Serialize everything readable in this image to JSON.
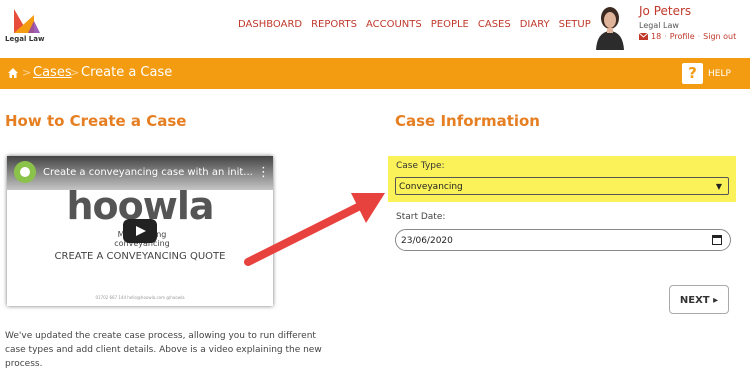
{
  "header": {
    "logo_text": "Legal Law",
    "nav": [
      "DASHBOARD",
      "REPORTS",
      "ACCOUNTS",
      "PEOPLE",
      "CASES",
      "DIARY",
      "SETUP"
    ],
    "user": {
      "name": "Jo Peters",
      "org": "Legal Law",
      "messages_count": "18",
      "profile_label": "Profile",
      "signout_label": "Sign out"
    }
  },
  "breadcrumb": {
    "cases": "Cases",
    "current": "Create a Case",
    "help_icon": "?",
    "help_label": "HELP"
  },
  "left": {
    "heading": "How to Create a Case",
    "video": {
      "title": "Create a conveyancing case with an init...",
      "brand": "hoowla",
      "tagline": "Modernising conveyancing",
      "caption": "CREATE A CONVEYANCING QUOTE",
      "footer": "01702 667 144   hello@hoowla.com   @hoowla"
    },
    "description": "We've updated the create case process, allowing you to run different case types and add client details. Above is a video explaining the new process."
  },
  "right": {
    "heading": "Case Information",
    "case_type_label": "Case Type:",
    "case_type_value": "Conveyancing",
    "start_date_label": "Start Date:",
    "start_date_value": "23/06/2020",
    "next_label": "NEXT ▸"
  },
  "colors": {
    "brand_orange": "#f39c12",
    "heading_orange": "#e67e22",
    "nav_red": "#c0392b",
    "highlight_yellow": "#fbf25a",
    "arrow_red": "#e8423e"
  }
}
